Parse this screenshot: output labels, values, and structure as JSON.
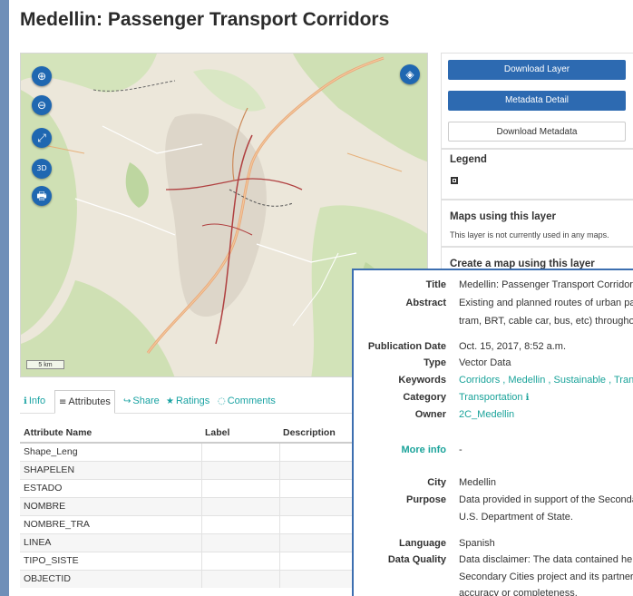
{
  "page": {
    "title": "Medellin: Passenger Transport Corridors"
  },
  "map": {
    "buttons": {
      "zoom_in": "⊕",
      "zoom_out": "⊖",
      "fullscreen": "⤢",
      "rotate": "3D",
      "print": "🖶",
      "layers": "◈"
    },
    "scale_label": "5 km"
  },
  "tabs": [
    {
      "icon": "ℹ",
      "label": "Info"
    },
    {
      "icon": "≡",
      "label": "Attributes"
    },
    {
      "icon": "↪",
      "label": "Share"
    },
    {
      "icon": "★",
      "label": "Ratings"
    },
    {
      "icon": "◌",
      "label": "Comments"
    }
  ],
  "attributes": {
    "headers": [
      "Attribute Name",
      "Label",
      "Description"
    ],
    "rows": [
      "Shape_Leng",
      "SHAPELEN",
      "ESTADO",
      "NOMBRE",
      "NOMBRE_TRA",
      "LINEA",
      "TIPO_SISTE",
      "OBJECTID"
    ]
  },
  "panel": {
    "download_layer": "Download Layer",
    "metadata_detail": "Metadata Detail",
    "download_metadata": "Download Metadata",
    "legend_title": "Legend",
    "maps_using_title": "Maps using this layer",
    "maps_using_text": "This layer is not currently used in any maps.",
    "create_map_title": "Create a map using this layer"
  },
  "info": {
    "title_label": "Title",
    "title_value": "Medellin: Passenger Transport Corridors",
    "abstract_label": "Abstract",
    "abstract_line1": "Existing and planned routes of urban pas",
    "abstract_line2": "tram, BRT, cable car, bus, etc) throughou",
    "pubdate_label": "Publication Date",
    "pubdate_value": "Oct. 15, 2017, 8:52 a.m.",
    "type_label": "Type",
    "type_value": "Vector Data",
    "keywords_label": "Keywords",
    "keywords_value": "Corridors , Medellin , Sustainable , Trans",
    "category_label": "Category",
    "category_value": "Transportation",
    "category_icon": "ℹ",
    "owner_label": "Owner",
    "owner_value": "2C_Medellin",
    "moreinfo_label": "More info",
    "moreinfo_value": "-",
    "city_label": "City",
    "city_value": "Medellin",
    "purpose_label": "Purpose",
    "purpose_line1": "Data provided in support of the Secondar",
    "purpose_line2": "U.S. Department of State.",
    "language_label": "Language",
    "language_value": "Spanish",
    "dq_label": "Data Quality",
    "dq_line1": "Data disclaimer: The data contained here",
    "dq_line2": "Secondary Cities project and its partners",
    "dq_line3": "accuracy or completeness."
  }
}
